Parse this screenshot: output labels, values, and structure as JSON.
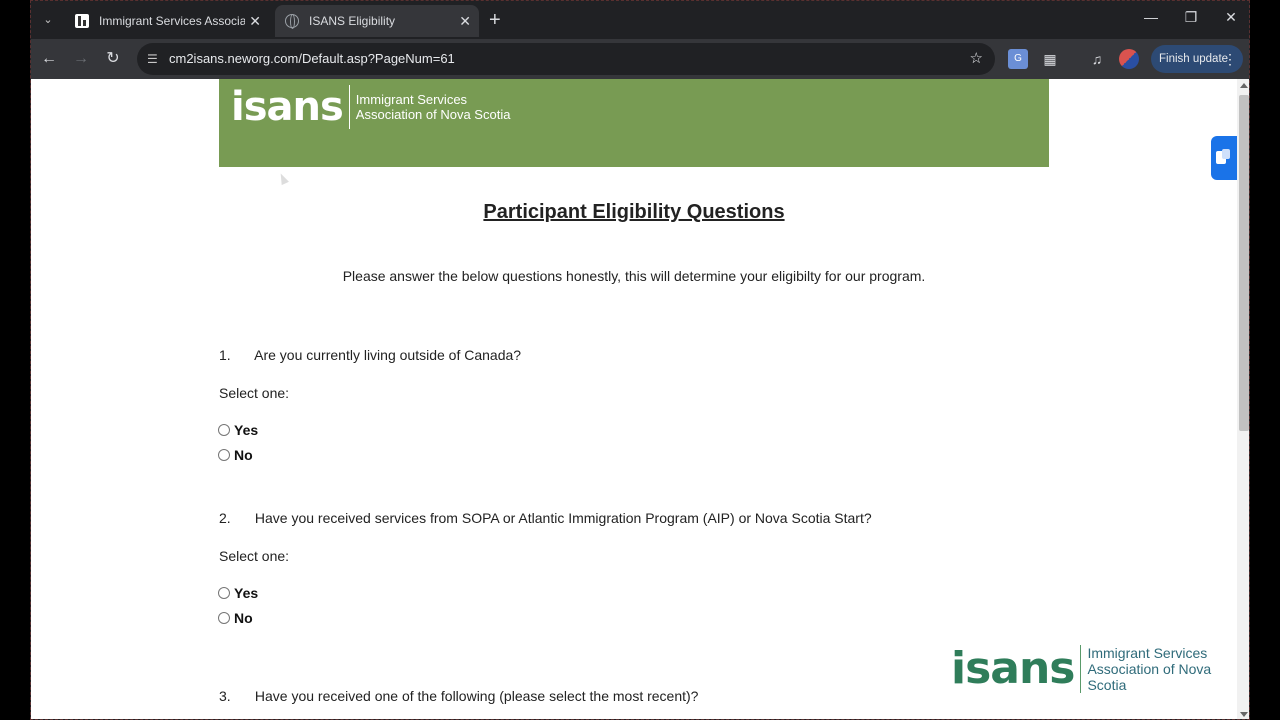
{
  "browser": {
    "tabs": [
      {
        "title": "Immigrant Services Association",
        "active": false
      },
      {
        "title": "ISANS Eligibility",
        "active": true
      }
    ],
    "url": "cm2isans.neworg.com/Default.asp?PageNum=61",
    "finish_update_label": "Finish update"
  },
  "banner": {
    "logo_word": "isans",
    "logo_line1": "Immigrant Services",
    "logo_line2": "Association of Nova Scotia",
    "color": "#789b53"
  },
  "page": {
    "title": "Participant Eligibility Questions",
    "intro": "Please answer the below questions honestly, this will determine your eligibilty for our program."
  },
  "questions": [
    {
      "number": "1.",
      "text": "Are you currently living outside of Canada?",
      "select_label": "Select one:",
      "options": [
        "Yes",
        "No"
      ]
    },
    {
      "number": "2.",
      "text": "Have you received services from SOPA or Atlantic Immigration Program (AIP) or Nova Scotia Start?",
      "select_label": "Select one:",
      "options": [
        "Yes",
        "No"
      ]
    },
    {
      "number": "3.",
      "text": "Have you received one of the following (please select the most recent)?"
    }
  ],
  "footer_logo": {
    "word": "isans",
    "line1": "Immigrant Services",
    "line2": "Association of Nova Scotia"
  }
}
